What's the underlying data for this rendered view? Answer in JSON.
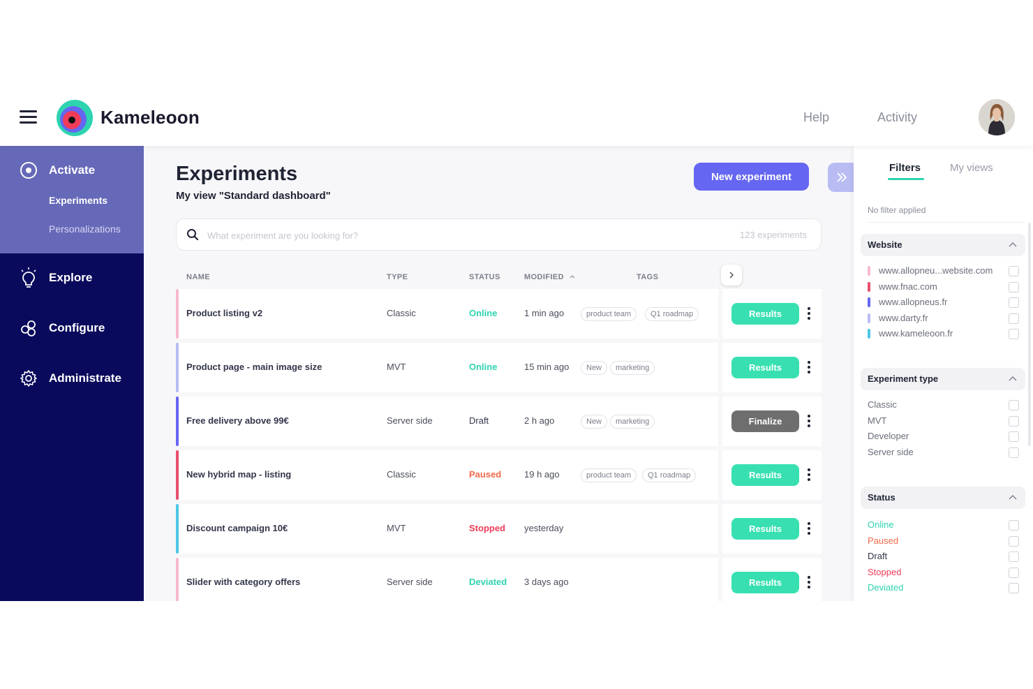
{
  "header": {
    "brand": "Kameleoon",
    "help_label": "Help",
    "activity_label": "Activity"
  },
  "sidebar": {
    "activate_label": "Activate",
    "experiments_label": "Experiments",
    "personalizations_label": "Personalizations",
    "explore_label": "Explore",
    "configure_label": "Configure",
    "administrate_label": "Administrate"
  },
  "main": {
    "title": "Experiments",
    "subtitle": "My view \"Standard dashboard\"",
    "new_button": "New experiment",
    "search_placeholder": "What experiment are you looking for?",
    "search_count": "123 experiments",
    "columns": {
      "name": "NAME",
      "type": "TYPE",
      "status": "STATUS",
      "modified": "MODIFIED",
      "tags": "TAGS"
    },
    "rows": [
      {
        "name": "Product listing v2",
        "type": "Classic",
        "status": "Online",
        "modified": "1 min ago",
        "tags": [
          "product team",
          "Q1 roadmap"
        ],
        "action": "Results"
      },
      {
        "name": "Product page - main image size",
        "type": "MVT",
        "status": "Online",
        "modified": "15 min ago",
        "tags": [
          "New",
          "marketing"
        ],
        "action": "Results"
      },
      {
        "name": "Free delivery above 99€",
        "type": "Server side",
        "status": "Draft",
        "modified": "2 h ago",
        "tags": [
          "New",
          "marketing"
        ],
        "action": "Finalize"
      },
      {
        "name": "New hybrid map - listing",
        "type": "Classic",
        "status": "Paused",
        "modified": "19 h ago",
        "tags": [
          "product team",
          "Q1 roadmap"
        ],
        "action": "Results"
      },
      {
        "name": "Discount campaign 10€",
        "type": "MVT",
        "status": "Stopped",
        "modified": "yesterday",
        "tags": [],
        "action": "Results"
      },
      {
        "name": "Slider with category offers",
        "type": "Server side",
        "status": "Deviated",
        "modified": "3 days ago",
        "tags": [],
        "action": "Results"
      }
    ]
  },
  "filters": {
    "tab_filters": "Filters",
    "tab_views": "My views",
    "no_filter": "No filter applied",
    "website": {
      "title": "Website",
      "items": [
        {
          "label": "www.allopneu...website.com",
          "color": "#f7b9cf"
        },
        {
          "label": "www.fnac.com",
          "color": "#e8506e"
        },
        {
          "label": "www.allopneus.fr",
          "color": "#6566f1"
        },
        {
          "label": "www.darty.fr",
          "color": "#b9bcf3"
        },
        {
          "label": "www.kameleoon.fr",
          "color": "#4fc6e8"
        }
      ]
    },
    "experiment_type": {
      "title": "Experiment type",
      "items": [
        "Classic",
        "MVT",
        "Developer",
        "Server side"
      ]
    },
    "status": {
      "title": "Status",
      "items": [
        {
          "label": "Online",
          "color": "#2ed3b0"
        },
        {
          "label": "Paused",
          "color": "#f0694a"
        },
        {
          "label": "Draft",
          "color": "#33364a"
        },
        {
          "label": "Stopped",
          "color": "#f03c5a"
        },
        {
          "label": "Deviated",
          "color": "#2ed3b0"
        }
      ]
    }
  },
  "colors": {
    "online": "#2ed3b0",
    "paused": "#f0694a",
    "stopped": "#f03c5a",
    "draft": "#33364a",
    "results_button": "#38e0b1",
    "finalize_button": "#6e6e6e",
    "accent": "#6566f1",
    "sidebar": "#0a0a5c",
    "sidebar_active": "#6669b8"
  }
}
